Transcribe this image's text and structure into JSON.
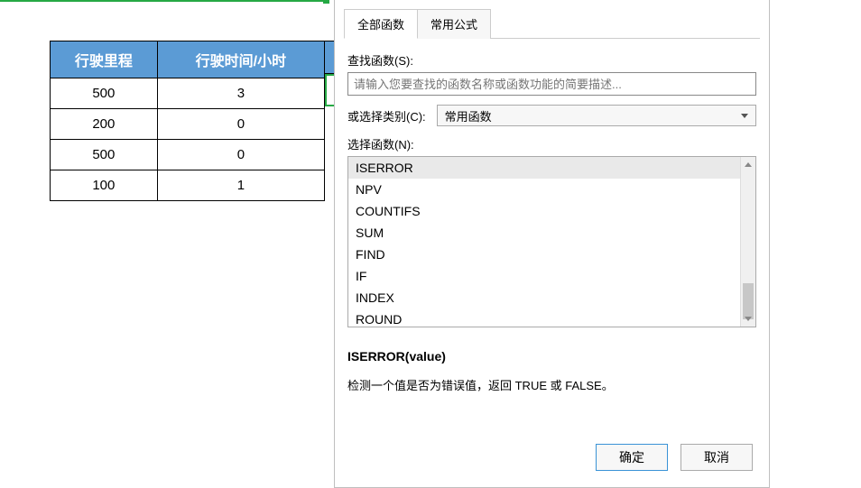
{
  "table": {
    "headers": [
      "行驶里程",
      "行驶时间/小时"
    ],
    "rows": [
      [
        "500",
        "3"
      ],
      [
        "200",
        "0"
      ],
      [
        "500",
        "0"
      ],
      [
        "100",
        "1"
      ]
    ]
  },
  "dialog": {
    "tabs": {
      "all": "全部函数",
      "common": "常用公式"
    },
    "search_label": "查找函数(S):",
    "search_placeholder": "请输入您要查找的函数名称或函数功能的简要描述...",
    "category_label": "或选择类别(C):",
    "category_value": "常用函数",
    "select_label": "选择函数(N):",
    "functions": [
      "ISERROR",
      "NPV",
      "COUNTIFS",
      "SUM",
      "FIND",
      "IF",
      "INDEX",
      "ROUND"
    ],
    "signature": "ISERROR(value)",
    "description": "检测一个值是否为错误值，返回 TRUE 或 FALSE。",
    "ok": "确定",
    "cancel": "取消"
  }
}
